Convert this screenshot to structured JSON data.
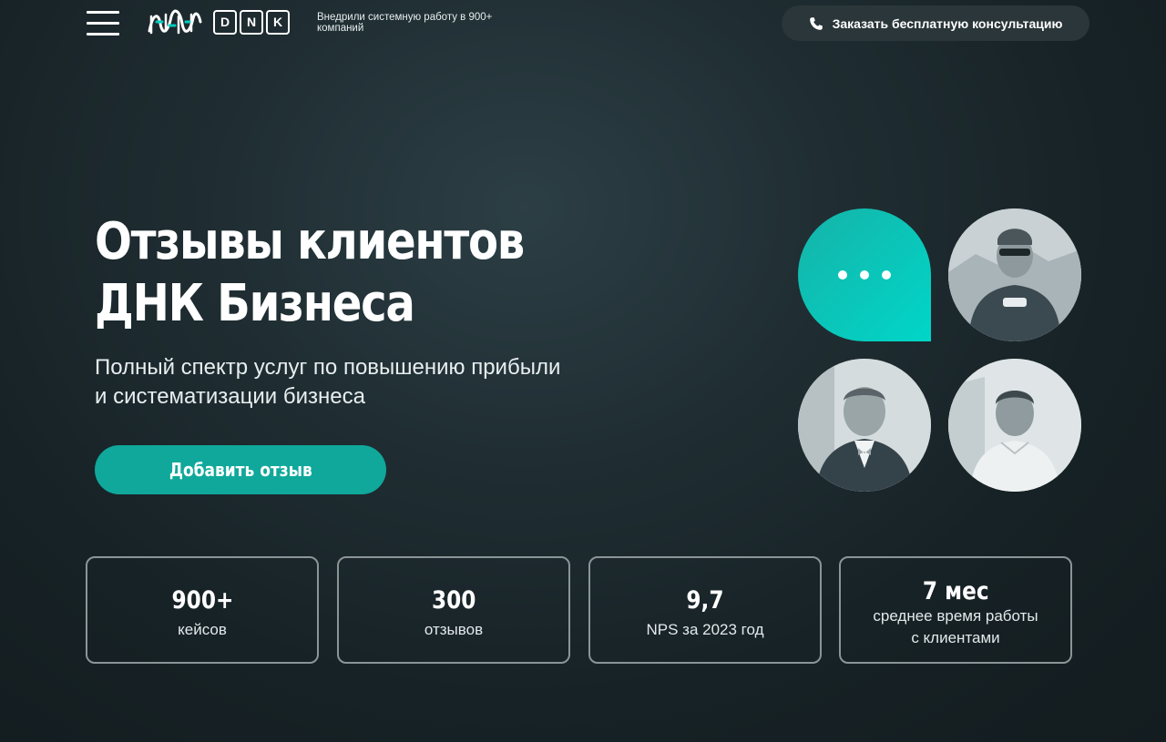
{
  "header": {
    "logo_letters": [
      "D",
      "N",
      "K"
    ],
    "tagline": "Внедрили системную работу в 900+ компаний",
    "cta_label": "Заказать бесплатную консультацию",
    "icons": {
      "menu": "hamburger-icon",
      "phone": "phone-icon",
      "logo": "dna-logo-icon"
    }
  },
  "hero": {
    "title_line1": "Отзывы клиентов",
    "title_line2": "ДНК Бизнеса",
    "subtitle": "Полный спектр услуг по повышению прибыли и систематизации бизнеса",
    "add_review_label": "Добавить отзыв"
  },
  "stats": [
    {
      "value": "900+",
      "label": "кейсов"
    },
    {
      "value": "300",
      "label": "отзывов"
    },
    {
      "value": "9,7",
      "label": "NPS за 2023 год"
    },
    {
      "value": "7 мес",
      "label": "среднее время работы с клиентами"
    }
  ],
  "colors": {
    "accent": "#0fa89b",
    "bubble_gradient_end": "#00d6c8",
    "background": "#1b272b",
    "cta_background": "#2a3639"
  }
}
